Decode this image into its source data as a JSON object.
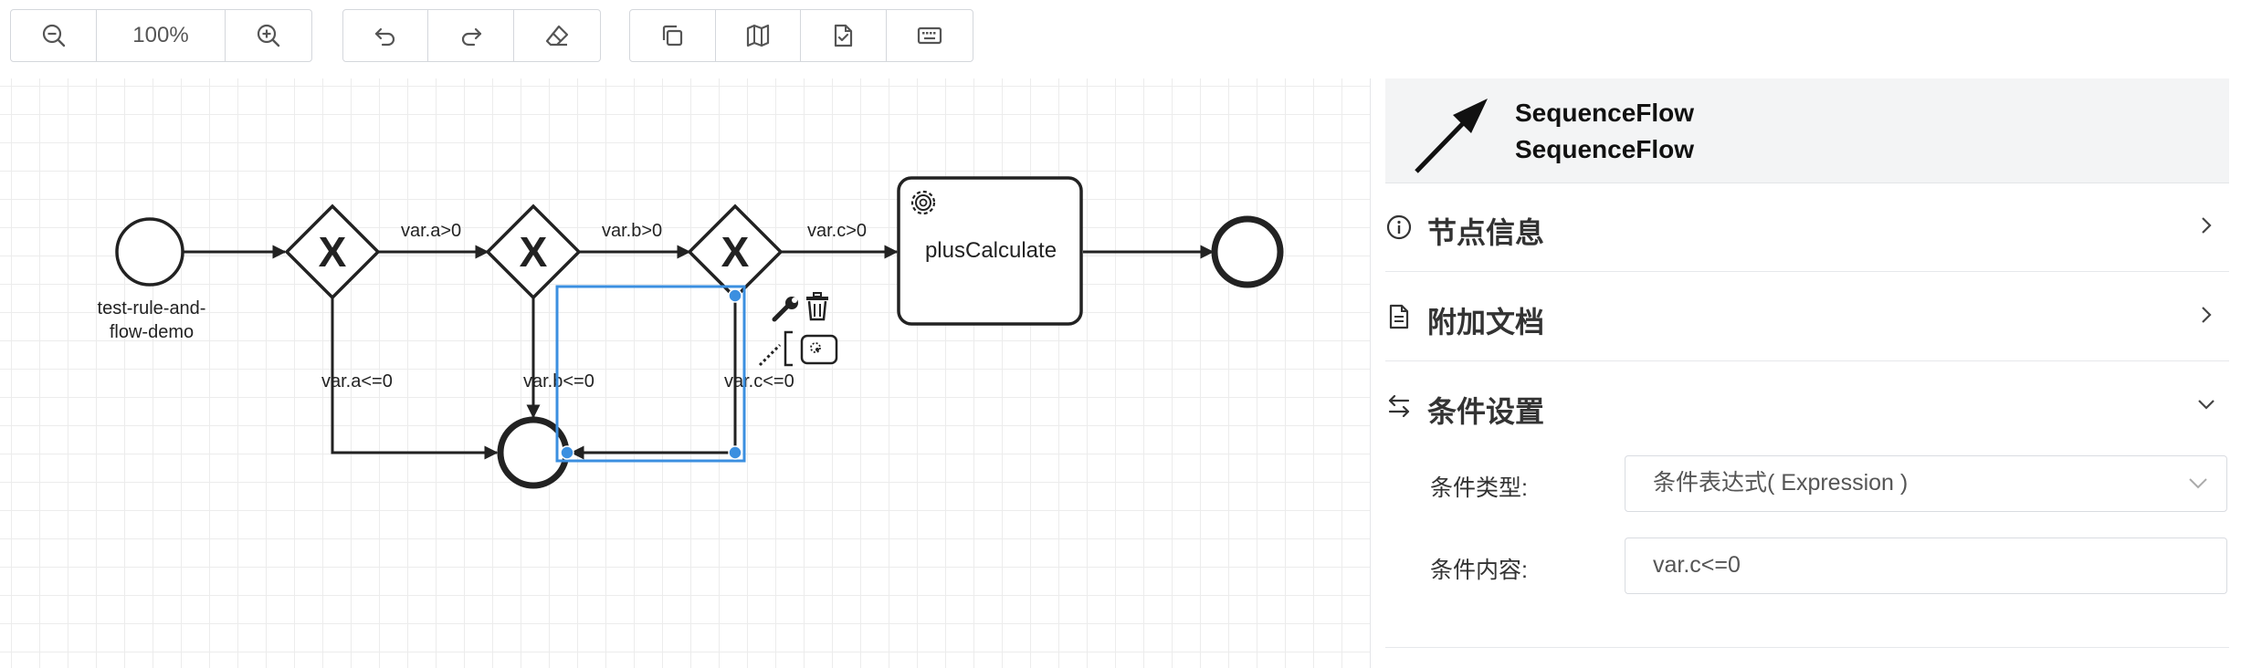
{
  "toolbar": {
    "zoom_out_icon": "zoom-out-icon",
    "zoom_level": "100%",
    "zoom_in_icon": "zoom-in-icon",
    "undo_icon": "undo-icon",
    "redo_icon": "redo-icon",
    "eraser_icon": "eraser-icon",
    "copy_icon": "copy-icon",
    "map_icon": "map-icon",
    "validate_icon": "file-check-icon",
    "keyboard_icon": "keyboard-icon"
  },
  "diagram": {
    "start_event_label_line1": "test-rule-and-",
    "start_event_label_line2": "flow-demo",
    "gateway_marker": "X",
    "flow_a_gt": "var.a>0",
    "flow_b_gt": "var.b>0",
    "flow_c_gt": "var.c>0",
    "flow_a_le": "var.a<=0",
    "flow_b_le": "var.b<=0",
    "flow_c_le": "var.c<=0",
    "task_label": "plusCalculate",
    "context_pad_icons": [
      "wrench-icon",
      "trash-icon",
      "connect-icon",
      "annotation-icon"
    ],
    "selection_color": "#3b8fe0"
  },
  "panel": {
    "header_line1": "SequenceFlow",
    "header_line2": "SequenceFlow",
    "sections": [
      {
        "title": "节点信息",
        "icon": "info-icon",
        "expanded": false
      },
      {
        "title": "附加文档",
        "icon": "document-icon",
        "expanded": false
      },
      {
        "title": "条件设置",
        "icon": "swap-icon",
        "expanded": true
      }
    ],
    "condition_type_label": "条件类型:",
    "condition_type_value": "条件表达式( Expression )",
    "condition_content_label": "条件内容:",
    "condition_content_value": "var.c<=0"
  }
}
